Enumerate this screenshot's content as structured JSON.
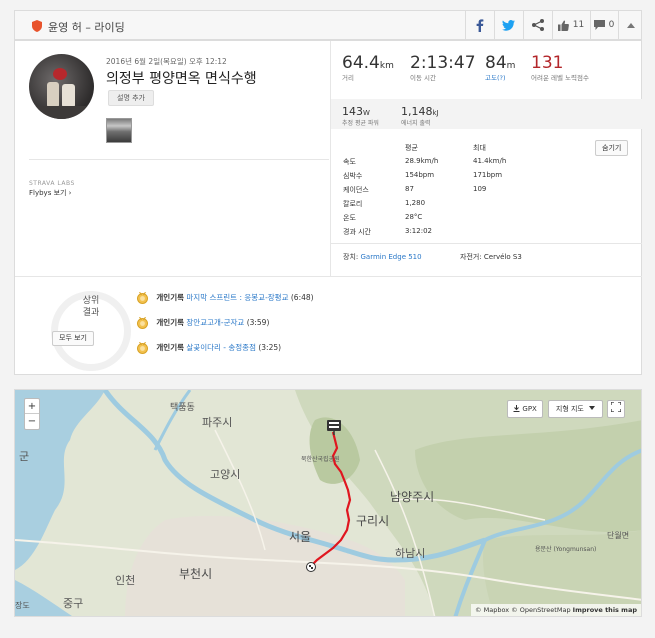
{
  "header": {
    "title": "윤영 허 – 라이딩",
    "kudos_count": "11",
    "comment_count": "0"
  },
  "activity": {
    "date": "2016년 6월 2일(목요일) 오후 12:12",
    "name": "의정부 평양면옥 면식수행",
    "add_description_label": "설명 추가",
    "labs_label": "STRAVA LABS",
    "flybys_label": "Flybys 보기 ›"
  },
  "stats": {
    "distance": {
      "value": "64.4",
      "unit": "km",
      "label": "거리"
    },
    "moving_time": {
      "value": "2:13:47",
      "label": "이동 시간"
    },
    "elevation": {
      "value": "84",
      "unit": "m",
      "label": "고도(?)"
    },
    "suffer": {
      "value": "131",
      "label": "어려운 레벨 노력점수"
    },
    "power": {
      "value": "143",
      "unit": "W",
      "label": "추정 평균 파워"
    },
    "energy": {
      "value": "1,148",
      "unit": "kJ",
      "label": "에너지 출력"
    }
  },
  "details": {
    "col_avg": "평균",
    "col_max": "최대",
    "hide_label": "숨기기",
    "rows": [
      {
        "label": "속도",
        "avg": "28.9km/h",
        "max": "41.4km/h"
      },
      {
        "label": "심박수",
        "avg": "154bpm",
        "max": "171bpm"
      },
      {
        "label": "케이던스",
        "avg": "87",
        "max": "109"
      },
      {
        "label": "칼로리",
        "avg": "1,280",
        "max": ""
      },
      {
        "label": "온도",
        "avg": "28°C",
        "max": ""
      },
      {
        "label": "경과 시간",
        "avg": "3:12:02",
        "max": ""
      }
    ],
    "device_label": "장치:",
    "device_value": "Garmin Edge 510",
    "bike_label": "자전거:",
    "bike_value": "Cervélo S3"
  },
  "achievements": {
    "ring_line1": "상위",
    "ring_line2": "결과",
    "view_all_label": "모두 보기",
    "items": [
      {
        "prefix": "개인기록",
        "segment": "마지막 스프린트 : 응봉교-장평교",
        "time": "(6:48)"
      },
      {
        "prefix": "개인기록",
        "segment": "장안교고개-군자교",
        "time": "(3:59)"
      },
      {
        "prefix": "개인기록",
        "segment": "살곶이다리 - 송정종점",
        "time": "(3:25)"
      }
    ]
  },
  "map": {
    "zoom_in": "+",
    "zoom_out": "−",
    "gpx_label": "GPX",
    "map_type_label": "지형 지도",
    "attribution_mapbox": "© Mapbox",
    "attribution_osm": "© OpenStreetMap",
    "attribution_improve": "Improve this map",
    "labels": {
      "paju": "파주시",
      "goyang": "고양시",
      "namyangju": "남양주시",
      "guri": "구리시",
      "seoul": "서울",
      "hanam": "하남시",
      "bucheon": "부천시",
      "incheon": "인천",
      "junggu": "중구",
      "gun": "군",
      "danwol": "단월면",
      "yongmunsan": "용문산 (Yongmunsan)",
      "taekpeum": "택품동",
      "jangdo": "장도",
      "kwandongsan": "북한산국립공원"
    },
    "route_color": "#e0161f"
  }
}
